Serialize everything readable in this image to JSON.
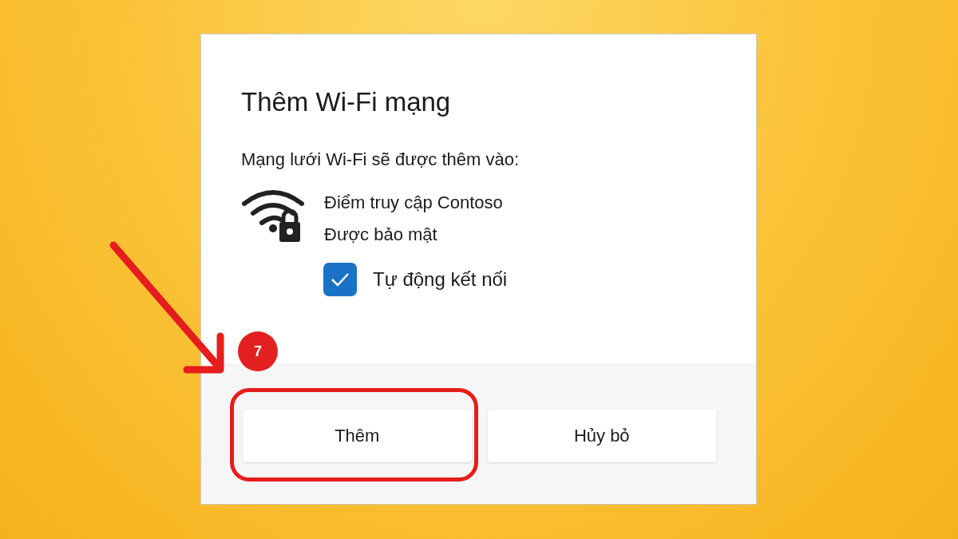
{
  "dialog": {
    "title": "Thêm Wi-Fi mạng",
    "message": "Mạng lưới Wi-Fi sẽ được thêm vào:",
    "network": {
      "name": "Điểm truy cập Contoso",
      "security": "Được bảo mật",
      "secured": true
    },
    "auto_connect": {
      "label": "Tự động kết nối",
      "checked": true
    },
    "buttons": [
      {
        "label": "Thêm",
        "highlighted": true
      },
      {
        "label": "Hủy bỏ",
        "highlighted": false
      }
    ]
  },
  "annotation": {
    "step": "7"
  }
}
